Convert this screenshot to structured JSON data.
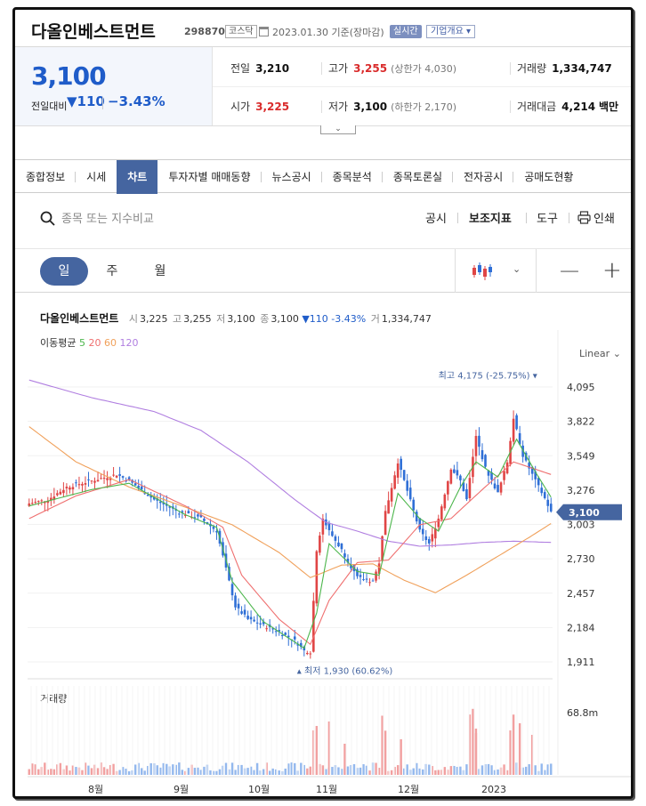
{
  "header": {
    "company_name": "다올인베스트먼트",
    "stock_code": "298870",
    "market": "코스닥",
    "date": "2023.01.30 기준(장마감)",
    "realtime": "실시간",
    "company_overview": "기업개요"
  },
  "quote": {
    "price": "3,100",
    "change_label": "전일대비",
    "change": "110",
    "change_pct": "−3.43%",
    "prev_close_label": "전일",
    "prev_close": "3,210",
    "high_label": "고가",
    "high": "3,255",
    "upper_limit": "(상한가 4,030)",
    "volume_label": "거래량",
    "volume": "1,334,747",
    "open_label": "시가",
    "open": "3,225",
    "low_label": "저가",
    "low": "3,100",
    "lower_limit": "(하한가 2,170)",
    "amount_label": "거래대금",
    "amount": "4,214",
    "amount_unit": "백만"
  },
  "tabs": [
    "종합정보",
    "시세",
    "차트",
    "투자자별 매매동향",
    "뉴스공시",
    "종목분석",
    "종목토론실",
    "전자공시",
    "공매도현황"
  ],
  "active_tab": "차트",
  "toolbar": {
    "search_placeholder": "종목 또는 지수비교",
    "disclosure": "공시",
    "indicators": "보조지표",
    "tools": "도구",
    "print": "인쇄"
  },
  "periods": [
    "일",
    "주",
    "월"
  ],
  "chart_legend": {
    "name": "다올인베스트먼트",
    "open_k": "시",
    "open": "3,225",
    "high_k": "고",
    "high": "3,255",
    "low_k": "저",
    "low": "3,100",
    "close_k": "종",
    "close": "3,100",
    "change": "▼110 -3.43%",
    "volume_k": "거",
    "volume": "1,334,747",
    "ma_label": "이동평균",
    "ma": [
      "5",
      "20",
      "60",
      "120"
    ]
  },
  "scale": "Linear",
  "volume_label": "거래량",
  "colors": {
    "up": "#e04545",
    "down": "#2f6fd6",
    "ma5": "#4cb64c",
    "ma20": "#ef6f6f",
    "ma60": "#f0a05a",
    "ma120": "#b07ee0",
    "accent": "#4565a0"
  },
  "chart_data": {
    "type": "candlestick",
    "y_ticks": [
      "4,095",
      "3,822",
      "3,549",
      "3,276",
      "3,003",
      "2,730",
      "2,457",
      "2,184",
      "1,911"
    ],
    "ylim": [
      1911,
      4095
    ],
    "x_ticks": [
      "8월",
      "9월",
      "10월",
      "11월",
      "12월",
      "2023"
    ],
    "current_price_label": "3,100",
    "max_annotation": "최고 4,175 (-25.75%)",
    "min_annotation": "최저 1,930 (60.62%)",
    "volume_max_label": "68.8m",
    "close_path": [
      [
        0,
        3170
      ],
      [
        6,
        3200
      ],
      [
        12,
        3300
      ],
      [
        20,
        3350
      ],
      [
        28,
        3400
      ],
      [
        32,
        3350
      ],
      [
        40,
        3200
      ],
      [
        48,
        3100
      ],
      [
        55,
        3050
      ],
      [
        60,
        2950
      ],
      [
        63,
        2650
      ],
      [
        66,
        2350
      ],
      [
        70,
        2250
      ],
      [
        75,
        2200
      ],
      [
        80,
        2150
      ],
      [
        85,
        2080
      ],
      [
        88,
        2000
      ],
      [
        90,
        1990
      ],
      [
        92,
        2800
      ],
      [
        94,
        3050
      ],
      [
        96,
        2950
      ],
      [
        100,
        2800
      ],
      [
        105,
        2580
      ],
      [
        110,
        2550
      ],
      [
        112,
        2700
      ],
      [
        114,
        3100
      ],
      [
        118,
        3500
      ],
      [
        120,
        3350
      ],
      [
        125,
        2950
      ],
      [
        128,
        2850
      ],
      [
        131,
        3050
      ],
      [
        135,
        3450
      ],
      [
        138,
        3350
      ],
      [
        140,
        3200
      ],
      [
        143,
        3700
      ],
      [
        146,
        3450
      ],
      [
        150,
        3250
      ],
      [
        153,
        3500
      ],
      [
        155,
        3850
      ],
      [
        158,
        3550
      ],
      [
        162,
        3350
      ],
      [
        165,
        3210
      ],
      [
        167,
        3100
      ]
    ],
    "ma5": [
      [
        0,
        3150
      ],
      [
        20,
        3280
      ],
      [
        32,
        3330
      ],
      [
        50,
        3080
      ],
      [
        60,
        2980
      ],
      [
        65,
        2550
      ],
      [
        75,
        2230
      ],
      [
        88,
        2020
      ],
      [
        92,
        2300
      ],
      [
        96,
        2850
      ],
      [
        105,
        2630
      ],
      [
        112,
        2600
      ],
      [
        118,
        3250
      ],
      [
        125,
        3050
      ],
      [
        131,
        2950
      ],
      [
        138,
        3300
      ],
      [
        143,
        3500
      ],
      [
        150,
        3380
      ],
      [
        156,
        3680
      ],
      [
        162,
        3420
      ],
      [
        167,
        3220
      ]
    ],
    "ma20": [
      [
        0,
        3050
      ],
      [
        15,
        3230
      ],
      [
        32,
        3360
      ],
      [
        50,
        3150
      ],
      [
        62,
        2980
      ],
      [
        68,
        2600
      ],
      [
        80,
        2250
      ],
      [
        90,
        2050
      ],
      [
        96,
        2400
      ],
      [
        105,
        2700
      ],
      [
        115,
        2720
      ],
      [
        125,
        3000
      ],
      [
        135,
        3050
      ],
      [
        145,
        3280
      ],
      [
        155,
        3500
      ],
      [
        167,
        3400
      ]
    ],
    "ma60": [
      [
        0,
        3780
      ],
      [
        15,
        3500
      ],
      [
        32,
        3300
      ],
      [
        50,
        3140
      ],
      [
        65,
        3000
      ],
      [
        80,
        2780
      ],
      [
        90,
        2580
      ],
      [
        100,
        2680
      ],
      [
        110,
        2690
      ],
      [
        120,
        2560
      ],
      [
        130,
        2460
      ],
      [
        140,
        2600
      ],
      [
        150,
        2750
      ],
      [
        160,
        2900
      ],
      [
        167,
        3010
      ]
    ],
    "ma120": [
      [
        0,
        4150
      ],
      [
        20,
        4010
      ],
      [
        40,
        3900
      ],
      [
        55,
        3750
      ],
      [
        70,
        3500
      ],
      [
        85,
        3200
      ],
      [
        95,
        3020
      ],
      [
        105,
        2950
      ],
      [
        115,
        2870
      ],
      [
        125,
        2830
      ],
      [
        135,
        2840
      ],
      [
        145,
        2860
      ],
      [
        155,
        2870
      ],
      [
        167,
        2860
      ]
    ],
    "max_point": [
      160,
      4175
    ],
    "min_point": [
      88,
      1930
    ]
  }
}
